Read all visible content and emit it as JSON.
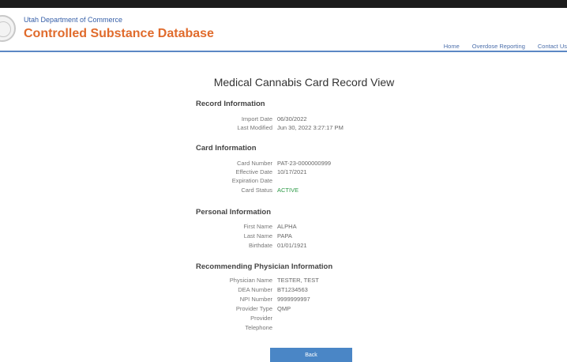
{
  "header": {
    "department": "Utah Department of Commerce",
    "app_title": "Controlled Substance Database",
    "nav": [
      "Home",
      "Overdose Reporting",
      "Contact Us"
    ]
  },
  "page": {
    "title": "Medical Cannabis Card Record View",
    "back_label": "Back"
  },
  "record_info": {
    "title": "Record Information",
    "rows": [
      {
        "label": "Import Date",
        "value": "06/30/2022"
      },
      {
        "label": "Last Modified",
        "value": "Jun 30, 2022 3:27:17 PM"
      }
    ]
  },
  "card_info": {
    "title": "Card Information",
    "rows": [
      {
        "label": "Card Number",
        "value": "PAT-23-0000000999"
      },
      {
        "label": "Effective Date",
        "value": "10/17/2021"
      },
      {
        "label": "Expiration Date",
        "value": ""
      },
      {
        "label": "Card Status",
        "value": "ACTIVE"
      }
    ]
  },
  "personal_info": {
    "title": "Personal Information",
    "rows": [
      {
        "label": "First Name",
        "value": "ALPHA"
      },
      {
        "label": "Last Name",
        "value": "PAPA"
      },
      {
        "label": "Birthdate",
        "value": "01/01/1921"
      }
    ]
  },
  "physician_info": {
    "title": "Recommending Physician Information",
    "rows": [
      {
        "label": "Physician Name",
        "value": "TESTER, TEST"
      },
      {
        "label": "DEA Number",
        "value": "BT1234563"
      },
      {
        "label": "NPI Number",
        "value": "9999999997"
      },
      {
        "label": "Provider Type",
        "value": "QMP"
      },
      {
        "label": "Provider",
        "value": ""
      },
      {
        "label": "Telephone",
        "value": ""
      }
    ]
  },
  "colors": {
    "brand_orange": "#e06b2c",
    "header_blue": "#365fa8",
    "status_active": "#2e9a47",
    "button_blue": "#4a86c6"
  },
  "icons": {
    "seal": "state-seal-icon"
  }
}
